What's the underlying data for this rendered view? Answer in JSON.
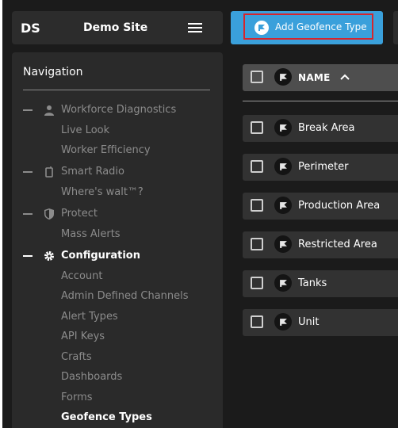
{
  "header": {
    "site_abbr": "DS",
    "site_name": "Demo Site"
  },
  "actions": {
    "add_label": "Add Geofence Type"
  },
  "nav": {
    "title": "Navigation",
    "items": [
      {
        "label": "Workforce Diagnostics",
        "icon": "person-icon",
        "kind": "parent"
      },
      {
        "label": "Live Look",
        "kind": "child"
      },
      {
        "label": "Worker Efficiency",
        "kind": "child"
      },
      {
        "label": "Smart Radio",
        "icon": "radio-icon",
        "kind": "parent"
      },
      {
        "label": "Where's walt™?",
        "kind": "child"
      },
      {
        "label": "Protect",
        "icon": "shield-icon",
        "kind": "parent"
      },
      {
        "label": "Mass Alerts",
        "kind": "child"
      },
      {
        "label": "Configuration",
        "icon": "gear-icon",
        "kind": "parent",
        "active": true
      },
      {
        "label": "Account",
        "kind": "child"
      },
      {
        "label": "Admin Defined Channels",
        "kind": "child"
      },
      {
        "label": "Alert Types",
        "kind": "child"
      },
      {
        "label": "API Keys",
        "kind": "child"
      },
      {
        "label": "Crafts",
        "kind": "child"
      },
      {
        "label": "Dashboards",
        "kind": "child"
      },
      {
        "label": "Forms",
        "kind": "child"
      },
      {
        "label": "Geofence Types",
        "kind": "child",
        "active": true
      }
    ]
  },
  "table": {
    "column_name": "NAME",
    "sort_direction": "ascending",
    "rows": [
      {
        "name": "Break Area"
      },
      {
        "name": "Perimeter"
      },
      {
        "name": "Production Area"
      },
      {
        "name": "Restricted Area"
      },
      {
        "name": "Tanks"
      },
      {
        "name": "Unit"
      }
    ]
  },
  "colors": {
    "background": "#1b1b1b",
    "panel": "#2a2a2a",
    "accent": "#3aa0db",
    "highlight_outline": "#d6252c"
  }
}
